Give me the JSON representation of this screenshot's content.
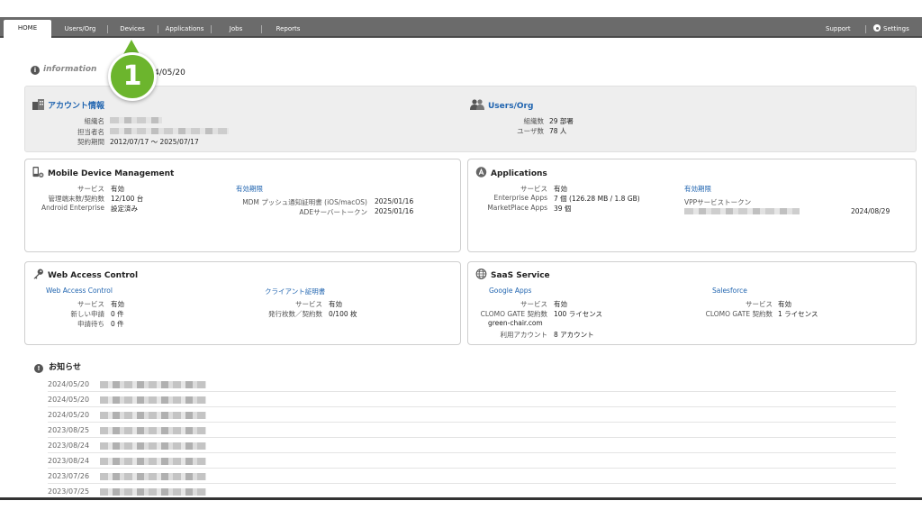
{
  "nav": {
    "tabs": [
      {
        "label": "HOME"
      },
      {
        "label": "Users/Org"
      },
      {
        "label": "Devices"
      },
      {
        "label": "Applications"
      },
      {
        "label": "Jobs"
      },
      {
        "label": "Reports"
      }
    ],
    "support": "Support",
    "settings": "Settings"
  },
  "info": {
    "label": "information",
    "text": "ル2024/05/20"
  },
  "callout": "1",
  "account": {
    "title": "アカウント情報",
    "rows": [
      {
        "key": "組織名"
      },
      {
        "key": "担当者名"
      },
      {
        "key": "契約期間",
        "value": "2012/07/17 〜 2025/07/17"
      }
    ]
  },
  "users_org": {
    "title": "Users/Org",
    "rows": [
      {
        "key": "組織数",
        "value": "29 部署"
      },
      {
        "key": "ユーザ数",
        "value": "78 人"
      }
    ]
  },
  "mdm": {
    "title": "Mobile Device Management",
    "rows": [
      {
        "key": "サービス",
        "value": "有効"
      },
      {
        "key": "管理端末数/契約数",
        "value": "12/100 台"
      },
      {
        "key": "Android Enterprise",
        "value": "設定済み"
      }
    ],
    "expiry_link": "有効期限",
    "expiry_rows": [
      {
        "key": "MDM プッシュ通知証明書 (iOS/macOS)",
        "value": "2025/01/16"
      },
      {
        "key": "ADEサーバートークン",
        "value": "2025/01/16"
      }
    ]
  },
  "applications": {
    "title": "Applications",
    "rows": [
      {
        "key": "サービス",
        "value": "有効"
      },
      {
        "key": "Enterprise Apps",
        "value": "7 個 (126.28 MB / 1.8 GB)"
      },
      {
        "key": "MarketPlace Apps",
        "value": "39 個"
      }
    ],
    "expiry_link": "有効期限",
    "vpp_label": "VPPサービストークン",
    "vpp_date": "2024/08/29"
  },
  "wac": {
    "title": "Web Access Control",
    "sublink": "Web Access Control",
    "rows": [
      {
        "key": "サービス",
        "value": "有効"
      },
      {
        "key": "新しい申請",
        "value": "0 件"
      },
      {
        "key": "申請待ち",
        "value": "0 件"
      }
    ],
    "client_link": "クライアント証明書",
    "client_rows": [
      {
        "key": "サービス",
        "value": "有効"
      },
      {
        "key": "発行枚数／契約数",
        "value": "0/100 枚"
      }
    ]
  },
  "saas": {
    "title": "SaaS Service",
    "google_link": "Google Apps",
    "google_rows": [
      {
        "key": "サービス",
        "value": "有効"
      },
      {
        "key": "CLOMO GATE 契約数",
        "value": "100 ライセンス"
      }
    ],
    "domain": "green-chair.com",
    "google_accounts": {
      "key": "利用アカウント",
      "value": "8 アカウント"
    },
    "salesforce_link": "Salesforce",
    "salesforce_rows": [
      {
        "key": "サービス",
        "value": "有効"
      },
      {
        "key": "CLOMO GATE 契約数",
        "value": "1 ライセンス"
      }
    ]
  },
  "news": {
    "title": "お知らせ",
    "items": [
      {
        "date": "2024/05/20"
      },
      {
        "date": "2024/05/20"
      },
      {
        "date": "2024/05/20"
      },
      {
        "date": "2023/08/25"
      },
      {
        "date": "2023/08/24"
      },
      {
        "date": "2023/08/24"
      },
      {
        "date": "2023/07/26"
      },
      {
        "date": "2023/07/25"
      }
    ]
  }
}
